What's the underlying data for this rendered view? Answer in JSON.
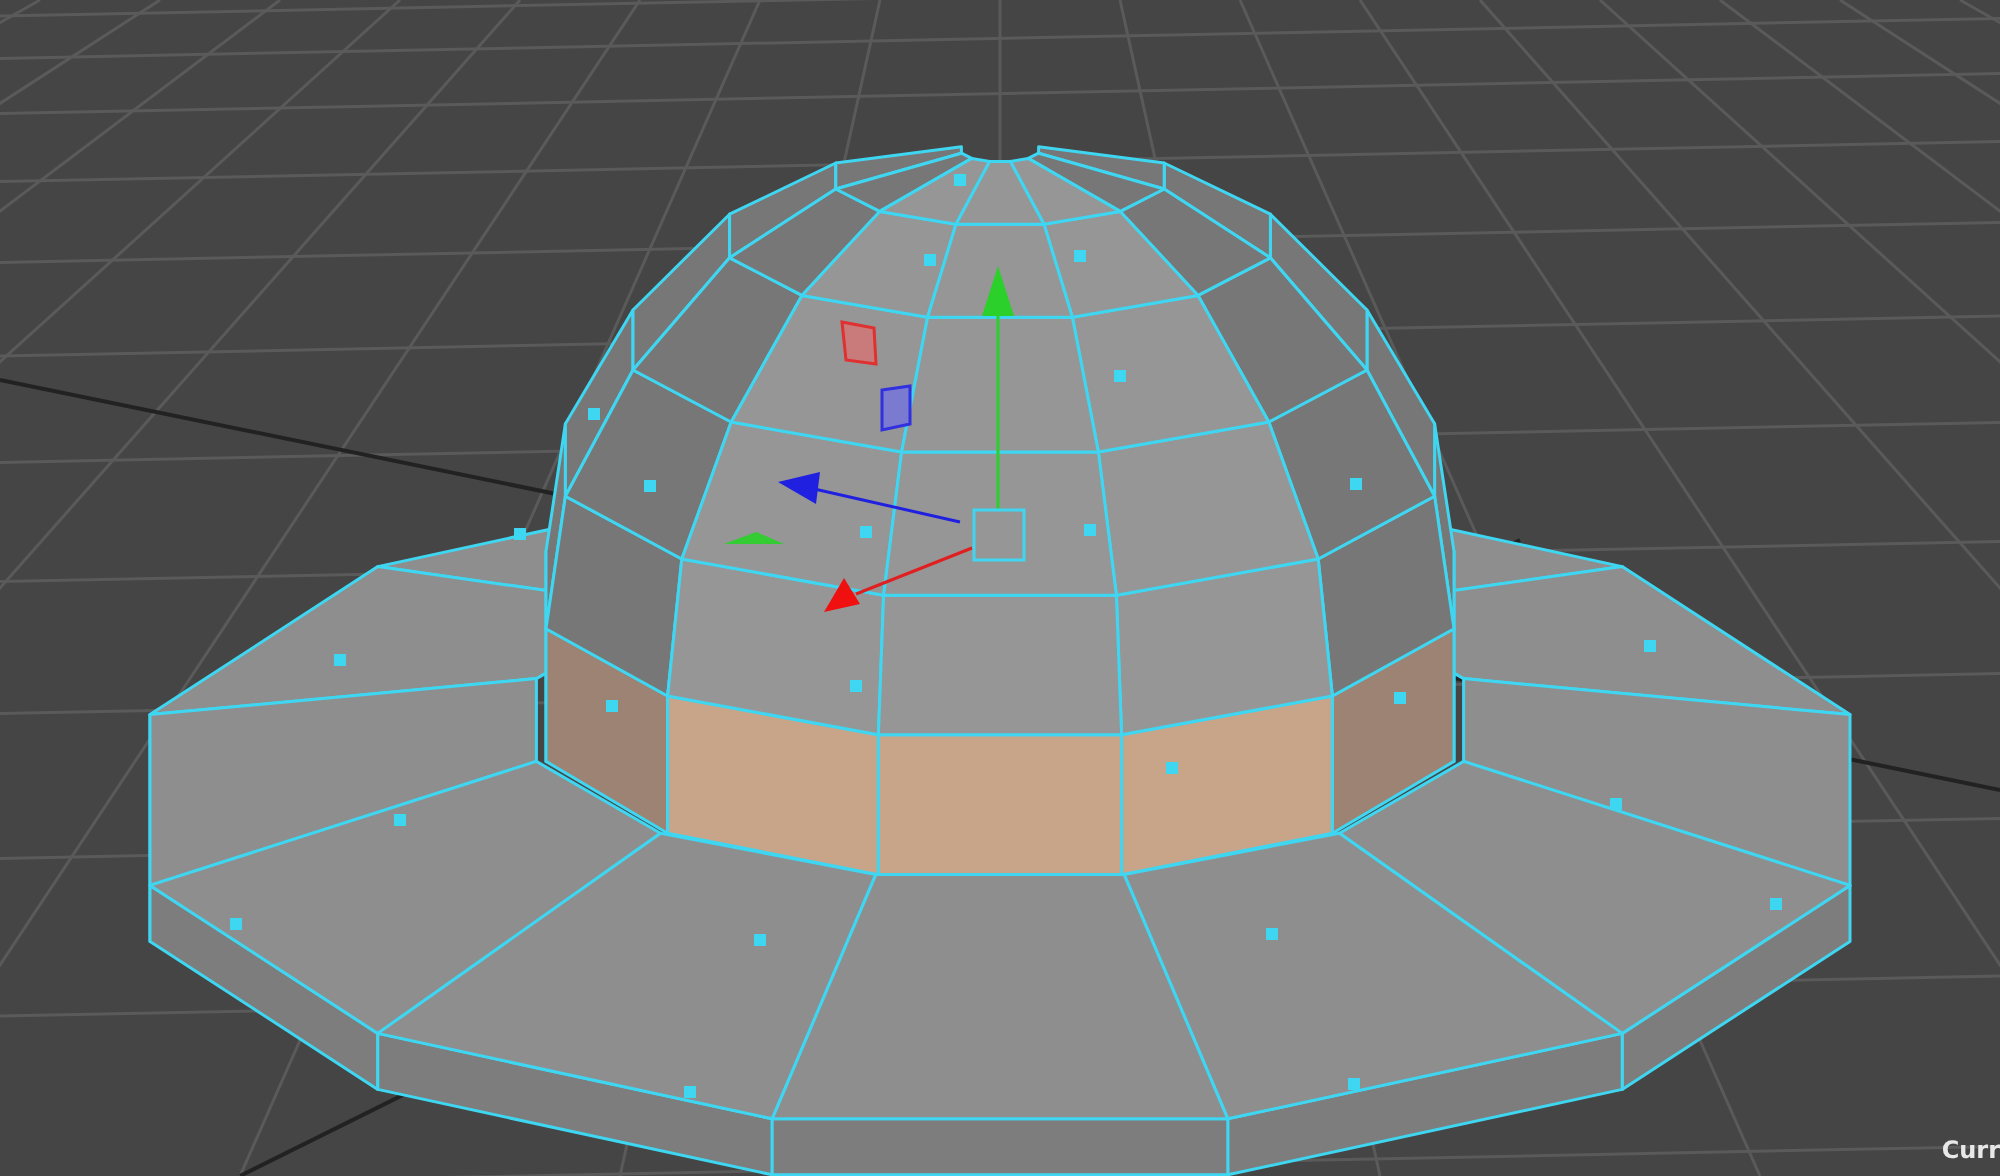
{
  "viewport": {
    "hud_text": "Curr"
  }
}
